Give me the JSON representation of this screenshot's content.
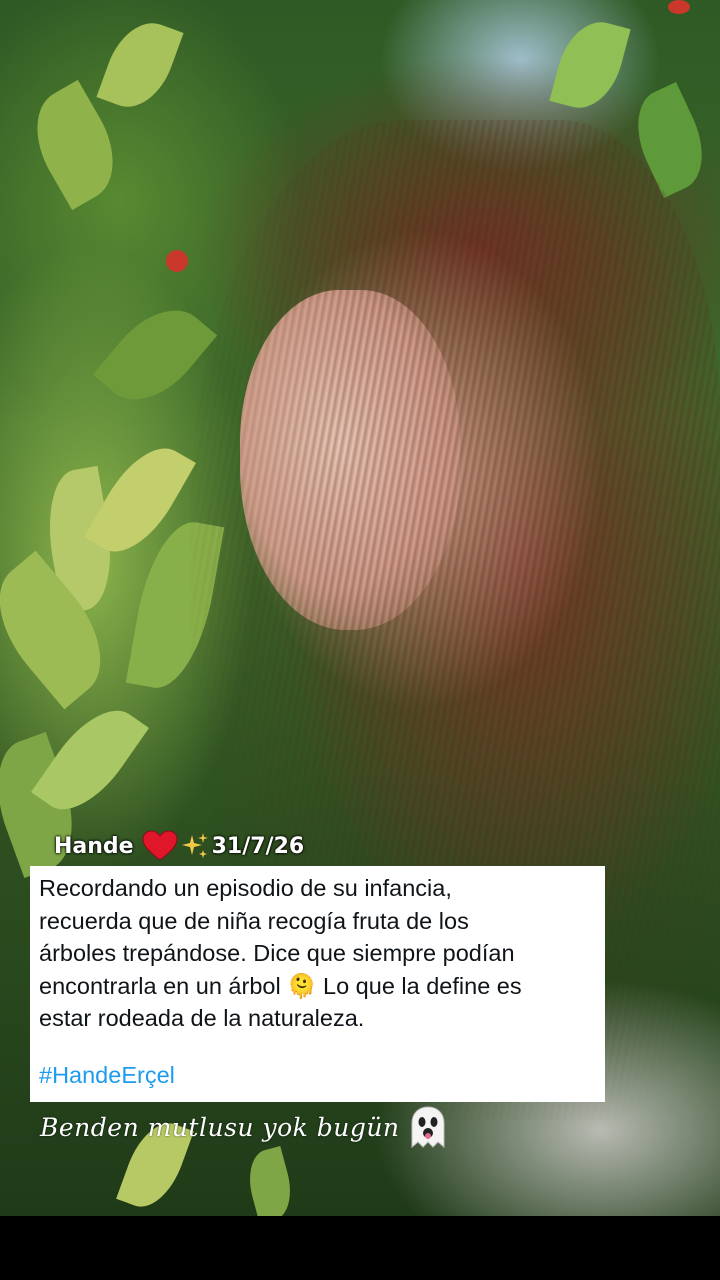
{
  "photo": {
    "subject": "photo-woman-in-cherry-tree",
    "colors": {
      "foliage": "#3e6b2a",
      "hair": "#7a3424",
      "skin": "#e8bba8",
      "sky": "#a9c9dd"
    }
  },
  "sticker": {
    "name": "Hande",
    "date": "31/7/26",
    "heart_icon": "red-heart-icon",
    "sparkle_icon": "sparkles-icon"
  },
  "caption": {
    "text": "Recordando un episodio de su infancia,\nrecuerda que de niña recogía fruta de los\nárboles trepándose. Dice que siempre podían\nencontrarla en un árbol 🫠 Lo que la define es\nestar rodeada de la naturaleza.",
    "hashtag": "#HandeErçel",
    "hashtag_color": "#1d9bf0"
  },
  "overlay_text": {
    "script": "Benden mutlusu yok bugün",
    "ghost_icon": "ghost-icon"
  }
}
